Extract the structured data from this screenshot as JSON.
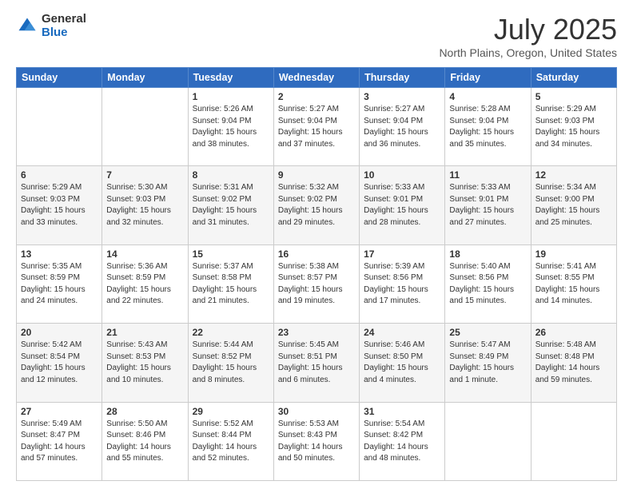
{
  "header": {
    "logo_general": "General",
    "logo_blue": "Blue",
    "month_title": "July 2025",
    "location": "North Plains, Oregon, United States"
  },
  "days_of_week": [
    "Sunday",
    "Monday",
    "Tuesday",
    "Wednesday",
    "Thursday",
    "Friday",
    "Saturday"
  ],
  "weeks": [
    [
      {
        "day": "",
        "sunrise": "",
        "sunset": "",
        "daylight": ""
      },
      {
        "day": "",
        "sunrise": "",
        "sunset": "",
        "daylight": ""
      },
      {
        "day": "1",
        "sunrise": "Sunrise: 5:26 AM",
        "sunset": "Sunset: 9:04 PM",
        "daylight": "Daylight: 15 hours and 38 minutes."
      },
      {
        "day": "2",
        "sunrise": "Sunrise: 5:27 AM",
        "sunset": "Sunset: 9:04 PM",
        "daylight": "Daylight: 15 hours and 37 minutes."
      },
      {
        "day": "3",
        "sunrise": "Sunrise: 5:27 AM",
        "sunset": "Sunset: 9:04 PM",
        "daylight": "Daylight: 15 hours and 36 minutes."
      },
      {
        "day": "4",
        "sunrise": "Sunrise: 5:28 AM",
        "sunset": "Sunset: 9:04 PM",
        "daylight": "Daylight: 15 hours and 35 minutes."
      },
      {
        "day": "5",
        "sunrise": "Sunrise: 5:29 AM",
        "sunset": "Sunset: 9:03 PM",
        "daylight": "Daylight: 15 hours and 34 minutes."
      }
    ],
    [
      {
        "day": "6",
        "sunrise": "Sunrise: 5:29 AM",
        "sunset": "Sunset: 9:03 PM",
        "daylight": "Daylight: 15 hours and 33 minutes."
      },
      {
        "day": "7",
        "sunrise": "Sunrise: 5:30 AM",
        "sunset": "Sunset: 9:03 PM",
        "daylight": "Daylight: 15 hours and 32 minutes."
      },
      {
        "day": "8",
        "sunrise": "Sunrise: 5:31 AM",
        "sunset": "Sunset: 9:02 PM",
        "daylight": "Daylight: 15 hours and 31 minutes."
      },
      {
        "day": "9",
        "sunrise": "Sunrise: 5:32 AM",
        "sunset": "Sunset: 9:02 PM",
        "daylight": "Daylight: 15 hours and 29 minutes."
      },
      {
        "day": "10",
        "sunrise": "Sunrise: 5:33 AM",
        "sunset": "Sunset: 9:01 PM",
        "daylight": "Daylight: 15 hours and 28 minutes."
      },
      {
        "day": "11",
        "sunrise": "Sunrise: 5:33 AM",
        "sunset": "Sunset: 9:01 PM",
        "daylight": "Daylight: 15 hours and 27 minutes."
      },
      {
        "day": "12",
        "sunrise": "Sunrise: 5:34 AM",
        "sunset": "Sunset: 9:00 PM",
        "daylight": "Daylight: 15 hours and 25 minutes."
      }
    ],
    [
      {
        "day": "13",
        "sunrise": "Sunrise: 5:35 AM",
        "sunset": "Sunset: 8:59 PM",
        "daylight": "Daylight: 15 hours and 24 minutes."
      },
      {
        "day": "14",
        "sunrise": "Sunrise: 5:36 AM",
        "sunset": "Sunset: 8:59 PM",
        "daylight": "Daylight: 15 hours and 22 minutes."
      },
      {
        "day": "15",
        "sunrise": "Sunrise: 5:37 AM",
        "sunset": "Sunset: 8:58 PM",
        "daylight": "Daylight: 15 hours and 21 minutes."
      },
      {
        "day": "16",
        "sunrise": "Sunrise: 5:38 AM",
        "sunset": "Sunset: 8:57 PM",
        "daylight": "Daylight: 15 hours and 19 minutes."
      },
      {
        "day": "17",
        "sunrise": "Sunrise: 5:39 AM",
        "sunset": "Sunset: 8:56 PM",
        "daylight": "Daylight: 15 hours and 17 minutes."
      },
      {
        "day": "18",
        "sunrise": "Sunrise: 5:40 AM",
        "sunset": "Sunset: 8:56 PM",
        "daylight": "Daylight: 15 hours and 15 minutes."
      },
      {
        "day": "19",
        "sunrise": "Sunrise: 5:41 AM",
        "sunset": "Sunset: 8:55 PM",
        "daylight": "Daylight: 15 hours and 14 minutes."
      }
    ],
    [
      {
        "day": "20",
        "sunrise": "Sunrise: 5:42 AM",
        "sunset": "Sunset: 8:54 PM",
        "daylight": "Daylight: 15 hours and 12 minutes."
      },
      {
        "day": "21",
        "sunrise": "Sunrise: 5:43 AM",
        "sunset": "Sunset: 8:53 PM",
        "daylight": "Daylight: 15 hours and 10 minutes."
      },
      {
        "day": "22",
        "sunrise": "Sunrise: 5:44 AM",
        "sunset": "Sunset: 8:52 PM",
        "daylight": "Daylight: 15 hours and 8 minutes."
      },
      {
        "day": "23",
        "sunrise": "Sunrise: 5:45 AM",
        "sunset": "Sunset: 8:51 PM",
        "daylight": "Daylight: 15 hours and 6 minutes."
      },
      {
        "day": "24",
        "sunrise": "Sunrise: 5:46 AM",
        "sunset": "Sunset: 8:50 PM",
        "daylight": "Daylight: 15 hours and 4 minutes."
      },
      {
        "day": "25",
        "sunrise": "Sunrise: 5:47 AM",
        "sunset": "Sunset: 8:49 PM",
        "daylight": "Daylight: 15 hours and 1 minute."
      },
      {
        "day": "26",
        "sunrise": "Sunrise: 5:48 AM",
        "sunset": "Sunset: 8:48 PM",
        "daylight": "Daylight: 14 hours and 59 minutes."
      }
    ],
    [
      {
        "day": "27",
        "sunrise": "Sunrise: 5:49 AM",
        "sunset": "Sunset: 8:47 PM",
        "daylight": "Daylight: 14 hours and 57 minutes."
      },
      {
        "day": "28",
        "sunrise": "Sunrise: 5:50 AM",
        "sunset": "Sunset: 8:46 PM",
        "daylight": "Daylight: 14 hours and 55 minutes."
      },
      {
        "day": "29",
        "sunrise": "Sunrise: 5:52 AM",
        "sunset": "Sunset: 8:44 PM",
        "daylight": "Daylight: 14 hours and 52 minutes."
      },
      {
        "day": "30",
        "sunrise": "Sunrise: 5:53 AM",
        "sunset": "Sunset: 8:43 PM",
        "daylight": "Daylight: 14 hours and 50 minutes."
      },
      {
        "day": "31",
        "sunrise": "Sunrise: 5:54 AM",
        "sunset": "Sunset: 8:42 PM",
        "daylight": "Daylight: 14 hours and 48 minutes."
      },
      {
        "day": "",
        "sunrise": "",
        "sunset": "",
        "daylight": ""
      },
      {
        "day": "",
        "sunrise": "",
        "sunset": "",
        "daylight": ""
      }
    ]
  ]
}
